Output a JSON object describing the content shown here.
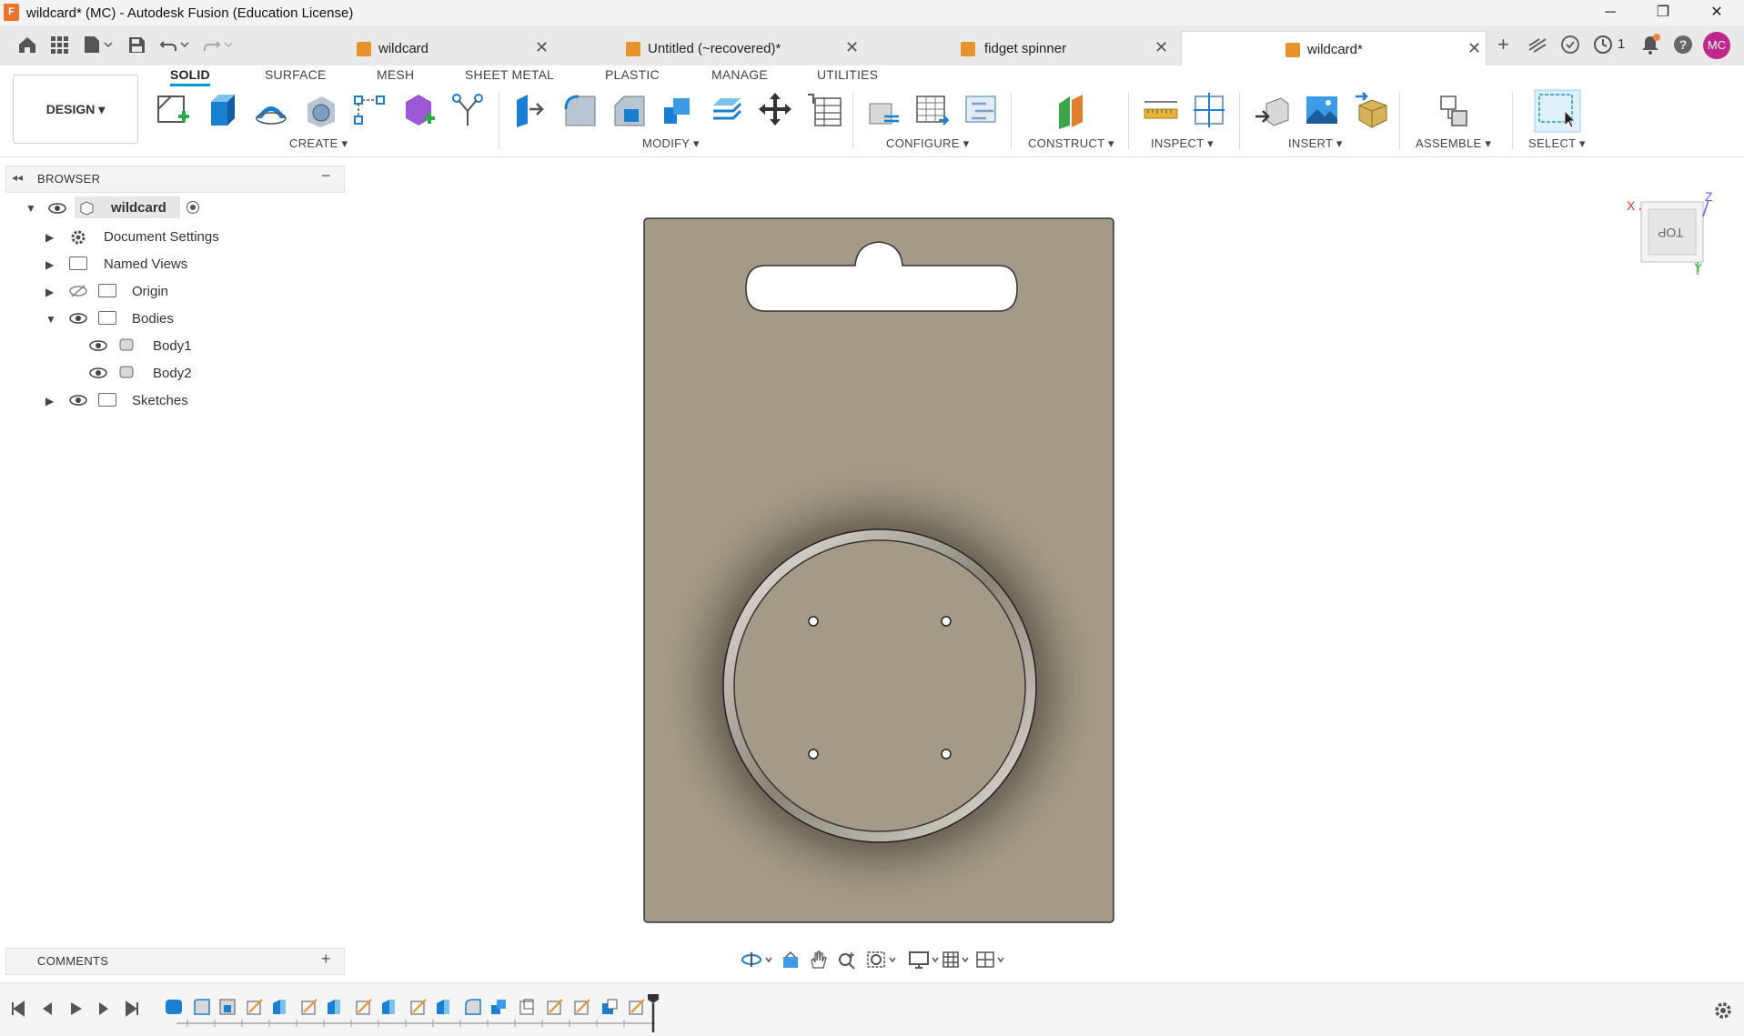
{
  "window": {
    "title": "wildcard* (MC) - Autodesk Fusion (Education License)",
    "app_icon_letter": "F",
    "controls": [
      "─",
      "❐",
      "✕"
    ]
  },
  "tabs": [
    {
      "label": "wildcard",
      "active": false
    },
    {
      "label": "Untitled (~recovered)*",
      "active": false
    },
    {
      "label": "fidget spinner",
      "active": false
    },
    {
      "label": "wildcard*",
      "active": true
    }
  ],
  "header_right": {
    "job_count": "1",
    "avatar": "MC"
  },
  "toolbar": {
    "workspace": "DESIGN",
    "top_tabs": [
      "SOLID",
      "SURFACE",
      "MESH",
      "SHEET METAL",
      "PLASTIC",
      "MANAGE",
      "UTILITIES"
    ],
    "active_tab": "SOLID",
    "groups": {
      "create": "CREATE",
      "modify": "MODIFY",
      "configure": "CONFIGURE",
      "construct": "CONSTRUCT",
      "inspect": "INSPECT",
      "insert": "INSERT",
      "assemble": "ASSEMBLE",
      "select": "SELECT"
    }
  },
  "browser": {
    "title": "BROWSER",
    "root": "wildcard",
    "items": [
      {
        "label": "Document Settings"
      },
      {
        "label": "Named Views"
      },
      {
        "label": "Origin"
      },
      {
        "label": "Bodies"
      },
      {
        "label": "Body1"
      },
      {
        "label": "Body2"
      },
      {
        "label": "Sketches"
      }
    ]
  },
  "comments": {
    "title": "COMMENTS"
  },
  "viewcube": {
    "face": "TOP",
    "axis_x": "X",
    "axis_y": "Y",
    "axis_z": "Z"
  },
  "colors": {
    "accent": "#0696d7",
    "body_fill": "#a39a87",
    "avatar": "#c0278a"
  }
}
